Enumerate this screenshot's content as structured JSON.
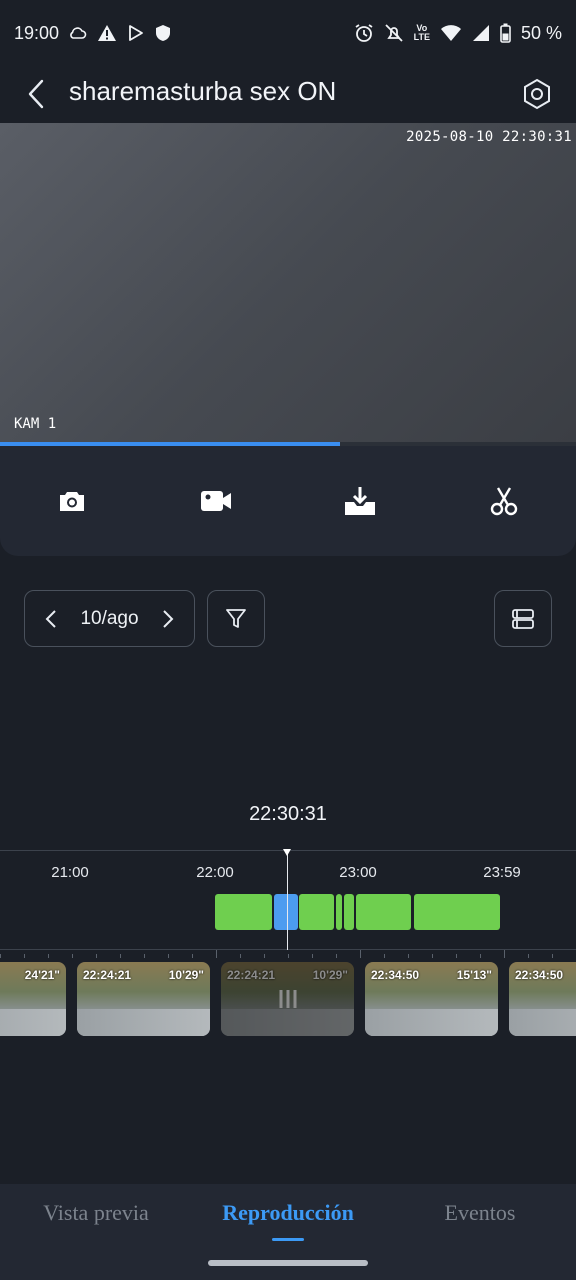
{
  "status_bar": {
    "time": "19:00",
    "battery": "50 %",
    "icons_left": [
      "cloud-icon",
      "warning-icon",
      "play-store-icon",
      "shield-icon"
    ],
    "icons_right": [
      "alarm-icon",
      "mute-icon",
      "volte-icon",
      "wifi-icon",
      "signal-icon",
      "battery-icon"
    ]
  },
  "header": {
    "title": "sharemasturba sex ON"
  },
  "video": {
    "osd_timestamp": "2025-08-10 22:30:31",
    "camera_label": "KAM 1",
    "progress": 0.59
  },
  "toolbar": {
    "buttons": [
      "camera-snapshot",
      "video-record",
      "download",
      "scissors-clip"
    ]
  },
  "date_nav": {
    "date": "10/ago"
  },
  "timeline": {
    "current_time": "22:30:31",
    "hours": [
      "21:00",
      "22:00",
      "23:00",
      "23:59"
    ]
  },
  "thumbnails": [
    {
      "start": "",
      "duration": "24'21\""
    },
    {
      "start": "22:24:21",
      "duration": "10'29\""
    },
    {
      "start": "22:24:21",
      "duration": "10'29\""
    },
    {
      "start": "22:34:50",
      "duration": "15'13\""
    },
    {
      "start": "22:34:50",
      "duration": ""
    }
  ],
  "bottom_nav": {
    "tabs": [
      "Vista previa",
      "Reproducción",
      "Eventos"
    ],
    "active": "Reproducción"
  },
  "colors": {
    "accent": "#3c9af5",
    "recording_segment": "#6fcf4f",
    "active_segment": "#4c9cf0",
    "background": "#1b1f27"
  }
}
